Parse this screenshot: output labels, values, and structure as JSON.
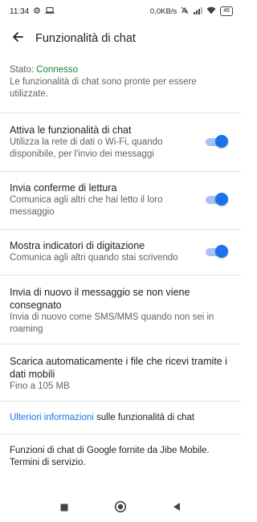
{
  "status_bar": {
    "time": "11:34",
    "network_speed": "0,0KB/s",
    "battery": "46",
    "icons": [
      "settings-icon",
      "laptop-icon",
      "mute-icon",
      "signal-icon",
      "wifi-icon",
      "battery-icon"
    ]
  },
  "header": {
    "back_icon": "arrow-back-icon",
    "title": "Funzionalità di chat"
  },
  "status": {
    "label": "Stato: ",
    "value": "Connesso",
    "description": "Le funzionalità di chat sono pronte per essere utilizzate."
  },
  "settings": [
    {
      "title": "Attiva le funzionalità di chat",
      "description": "Utilizza la rete di dati o Wi-Fi, quando disponibile, per l'invio dei messaggi",
      "enabled": true
    },
    {
      "title": "Invia conferme di lettura",
      "description": "Comunica agli altri che hai letto il loro messaggio",
      "enabled": true
    },
    {
      "title": "Mostra indicatori di digitazione",
      "description": "Comunica agli altri quando stai scrivendo",
      "enabled": true
    },
    {
      "title": "Invia di nuovo il messaggio se non viene consegnato",
      "description": "Invia di nuovo come SMS/MMS quando non sei in roaming"
    },
    {
      "title": "Scarica automaticamente i file che ricevi tramite i dati mobili",
      "description": "Fino a 105 MB"
    }
  ],
  "more_info": {
    "link": "Ulteriori informazioni",
    "suffix": " sulle funzionalità di chat"
  },
  "footer": {
    "text": "Funzioni di chat di Google fornite da Jibe Mobile. Termini di servizio."
  },
  "colors": {
    "accent": "#1a73e8",
    "connected": "#188038"
  }
}
